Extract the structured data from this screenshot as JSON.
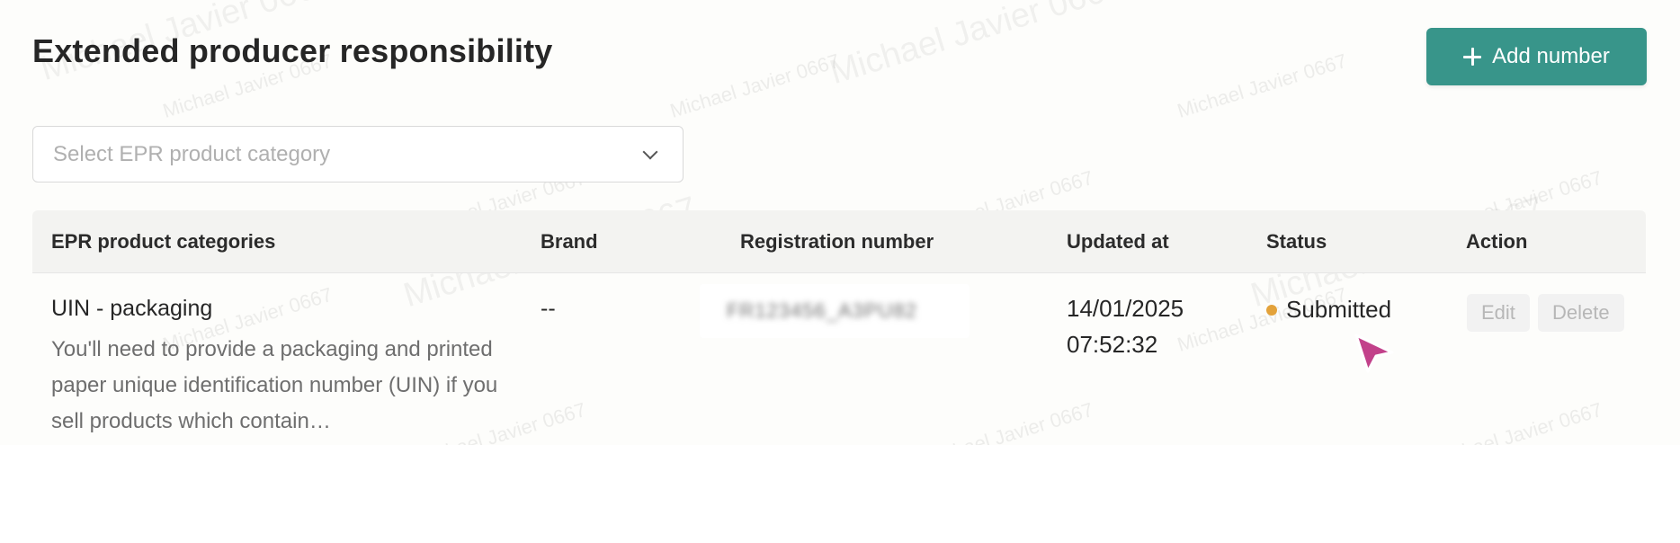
{
  "page": {
    "title": "Extended producer responsibility",
    "add_button_label": "Add number"
  },
  "filter": {
    "placeholder": "Select EPR product category"
  },
  "table": {
    "columns": [
      "EPR product categories",
      "Brand",
      "Registration number",
      "Updated at",
      "Status",
      "Action"
    ],
    "rows": [
      {
        "category": "UIN - packaging",
        "description": "You'll need to provide a packaging and printed paper unique identification number (UIN) if you sell products which contain…",
        "brand": "--",
        "registration_number": "FR123456_A3PU82",
        "updated_date": "14/01/2025",
        "updated_time": "07:52:32",
        "status": "Submitted",
        "edit_label": "Edit",
        "delete_label": "Delete"
      }
    ]
  },
  "watermark": "Michael Javier 0667",
  "colors": {
    "accent": "#38958a",
    "status_submitted": "#e3a23a",
    "cursor": "#c2418a"
  },
  "icons": [
    "plus-icon",
    "chevron-down-icon",
    "status-dot-icon",
    "cursor-icon"
  ]
}
